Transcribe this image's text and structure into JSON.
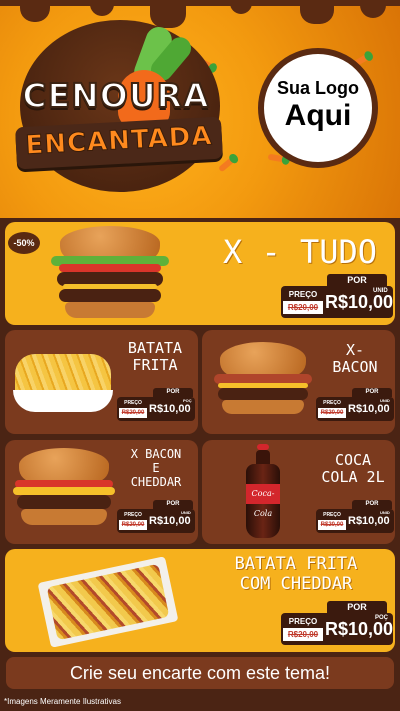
{
  "brand": {
    "title_line1": "CENOURA",
    "title_line2": "ENCANTADA"
  },
  "logo": {
    "line1": "Sua Logo",
    "line2": "Aqui"
  },
  "items": [
    {
      "name": "X - TUDO",
      "badge": "-50%",
      "tag_label": "POR",
      "preco_label": "PREÇO",
      "old_price": "R$20,00",
      "new_price": "R$10,00",
      "unit": "UNID"
    },
    {
      "name_line1": "BATATA",
      "name_line2": "FRITA",
      "tag_label": "POR",
      "preco_label": "PREÇO",
      "old_price": "R$20,00",
      "new_price": "R$10,00",
      "unit": "POÇ"
    },
    {
      "name_line1": "X-",
      "name_line2": "BACON",
      "tag_label": "POR",
      "preco_label": "PREÇO",
      "old_price": "R$20,00",
      "new_price": "R$10,00",
      "unit": "UNID"
    },
    {
      "name_line1": "X BACON",
      "name_line2": "E",
      "name_line3": "CHEDDAR",
      "tag_label": "POR",
      "preco_label": "PREÇO",
      "old_price": "R$20,00",
      "new_price": "R$10,00",
      "unit": "UNID"
    },
    {
      "name_line1": "COCA",
      "name_line2": "COLA 2L",
      "bottle_label": "Coca-Cola",
      "tag_label": "POR",
      "preco_label": "PREÇO",
      "old_price": "R$20,00",
      "new_price": "R$10,00",
      "unit": "UNID"
    },
    {
      "name_line1": "BATATA FRITA",
      "name_line2": "COM CHEDDAR",
      "tag_label": "POR",
      "preco_label": "PREÇO",
      "old_price": "R$20,00",
      "new_price": "R$10,00",
      "unit": "POÇ"
    }
  ],
  "cta": "Crie seu encarte com este tema!",
  "disclaimer": "*Imagens Meramente Ilustrativas",
  "colors": {
    "orange": "#f39a0f",
    "yellow_card": "#f6b11d",
    "brown_card": "#7b3a1e",
    "dark_brown": "#4b2414"
  }
}
